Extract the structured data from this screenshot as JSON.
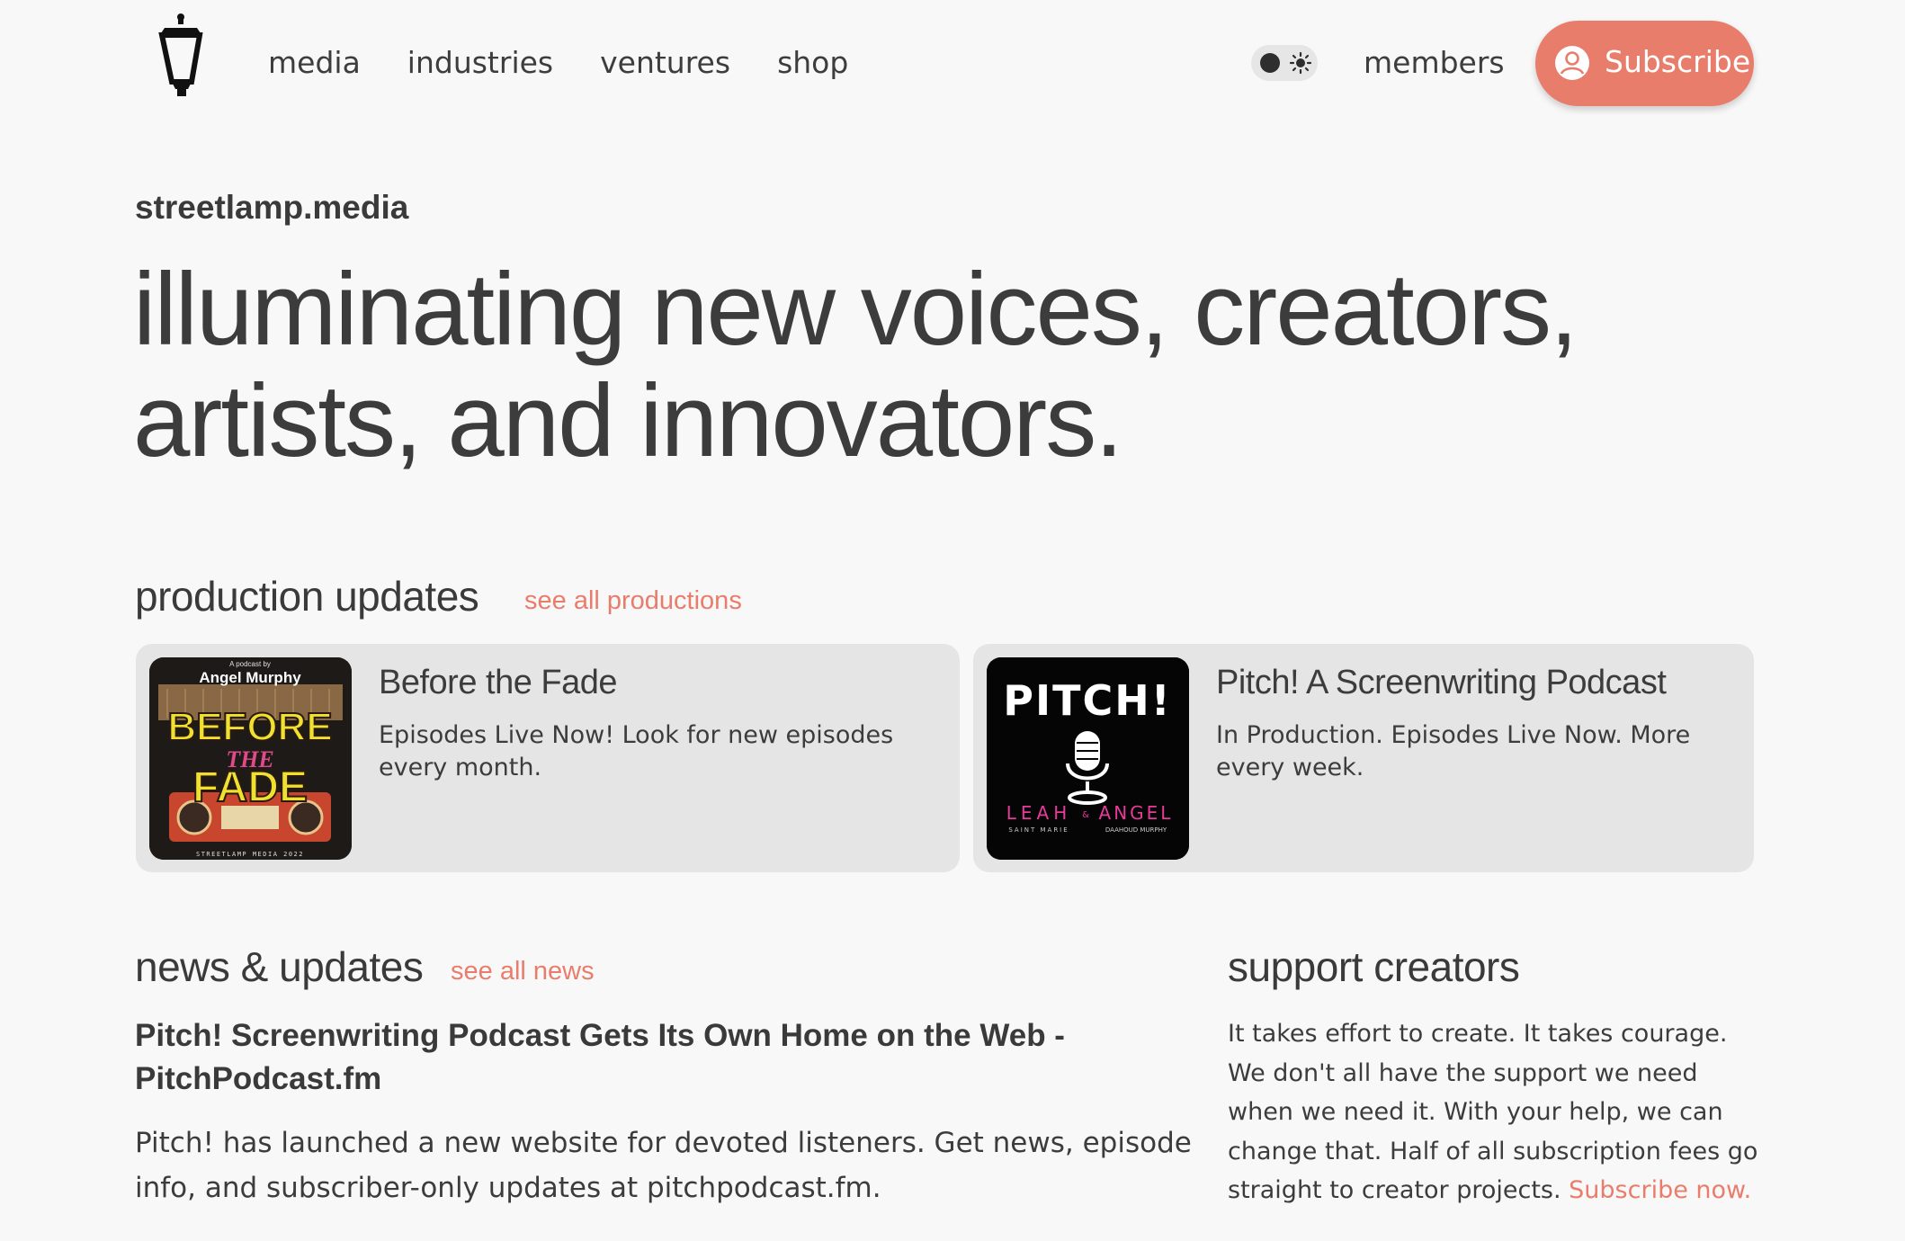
{
  "nav": {
    "items": [
      "media",
      "industries",
      "ventures",
      "shop"
    ],
    "members": "members",
    "subscribe": "Subscribe"
  },
  "hero": {
    "site_name": "streetlamp.media",
    "headline": "illuminating new voices, creators, artists, and innovators."
  },
  "productions": {
    "title": "production updates",
    "link": "see all productions",
    "cards": [
      {
        "title": "Before the Fade",
        "description": "Episodes Live Now! Look for new episodes every month.",
        "art": {
          "top": "A podcast by",
          "author": "Angel Murphy",
          "line1": "BEFORE",
          "line2": "THE",
          "line3": "FADE",
          "footer": "STREETLAMP MEDIA 2022"
        }
      },
      {
        "title": "Pitch! A Screenwriting Podcast",
        "description": "In Production. Episodes Live Now. More every week.",
        "art": {
          "title": "PITCH!",
          "host1": "LEAH",
          "amp": "&",
          "host2": "ANGEL",
          "host1_sub": "SAINT MARIE",
          "host2_sub": "DAAHOUD MURPHY"
        }
      }
    ]
  },
  "news": {
    "title": "news & updates",
    "link": "see all news",
    "headline": "Pitch! Screenwriting Podcast Gets Its Own Home on the Web - PitchPodcast.fm",
    "body": "Pitch! has launched a new website for devoted listeners. Get news, episode info, and subscriber-only updates at pitchpodcast.fm."
  },
  "support": {
    "title": "support creators",
    "body": "It takes effort to create. It takes courage. We don't all have the support we need when we need it. With your help, we can change that. Half of all subscription fees go straight to creator projects.",
    "link": "Subscribe now."
  },
  "colors": {
    "accent": "#e97d6b",
    "background": "#f9f8f8",
    "card": "#e6e5e5",
    "text": "#3a3a3a"
  },
  "icons": [
    "streetlamp-logo",
    "moon-toggle",
    "sun-icon",
    "user-icon",
    "microphone-icon"
  ]
}
